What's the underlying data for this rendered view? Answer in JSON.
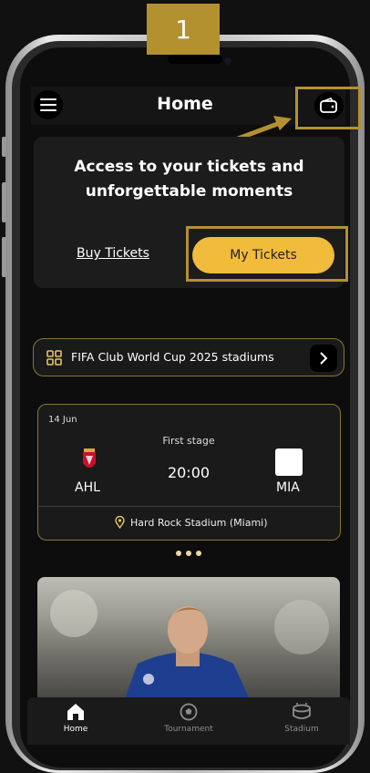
{
  "step": "1",
  "header": {
    "title": "Home",
    "menu_icon": "menu-icon",
    "wallet_icon": "wallet-icon"
  },
  "tickets": {
    "heading_line1": "Access to your tickets and",
    "heading_line2": "unforgettable moments",
    "buy_label": "Buy Tickets",
    "my_tickets_label": "My Tickets"
  },
  "stadiums": {
    "label": "FIFA Club World Cup 2025 stadiums"
  },
  "match": {
    "date": "14 Jun",
    "stage": "First stage",
    "time": "20:00",
    "home_code": "AHL",
    "away_code": "MIA",
    "venue": "Hard Rock Stadium (Miami)"
  },
  "nav": {
    "items": [
      {
        "label": "Home",
        "icon": "home-icon",
        "active": true
      },
      {
        "label": "Tournament",
        "icon": "ball-icon",
        "active": false
      },
      {
        "label": "Stadium",
        "icon": "stadium-icon",
        "active": false
      }
    ]
  },
  "colors": {
    "accent": "#f1bb3c",
    "highlight": "#b3912f",
    "background": "#0d0d0d"
  }
}
